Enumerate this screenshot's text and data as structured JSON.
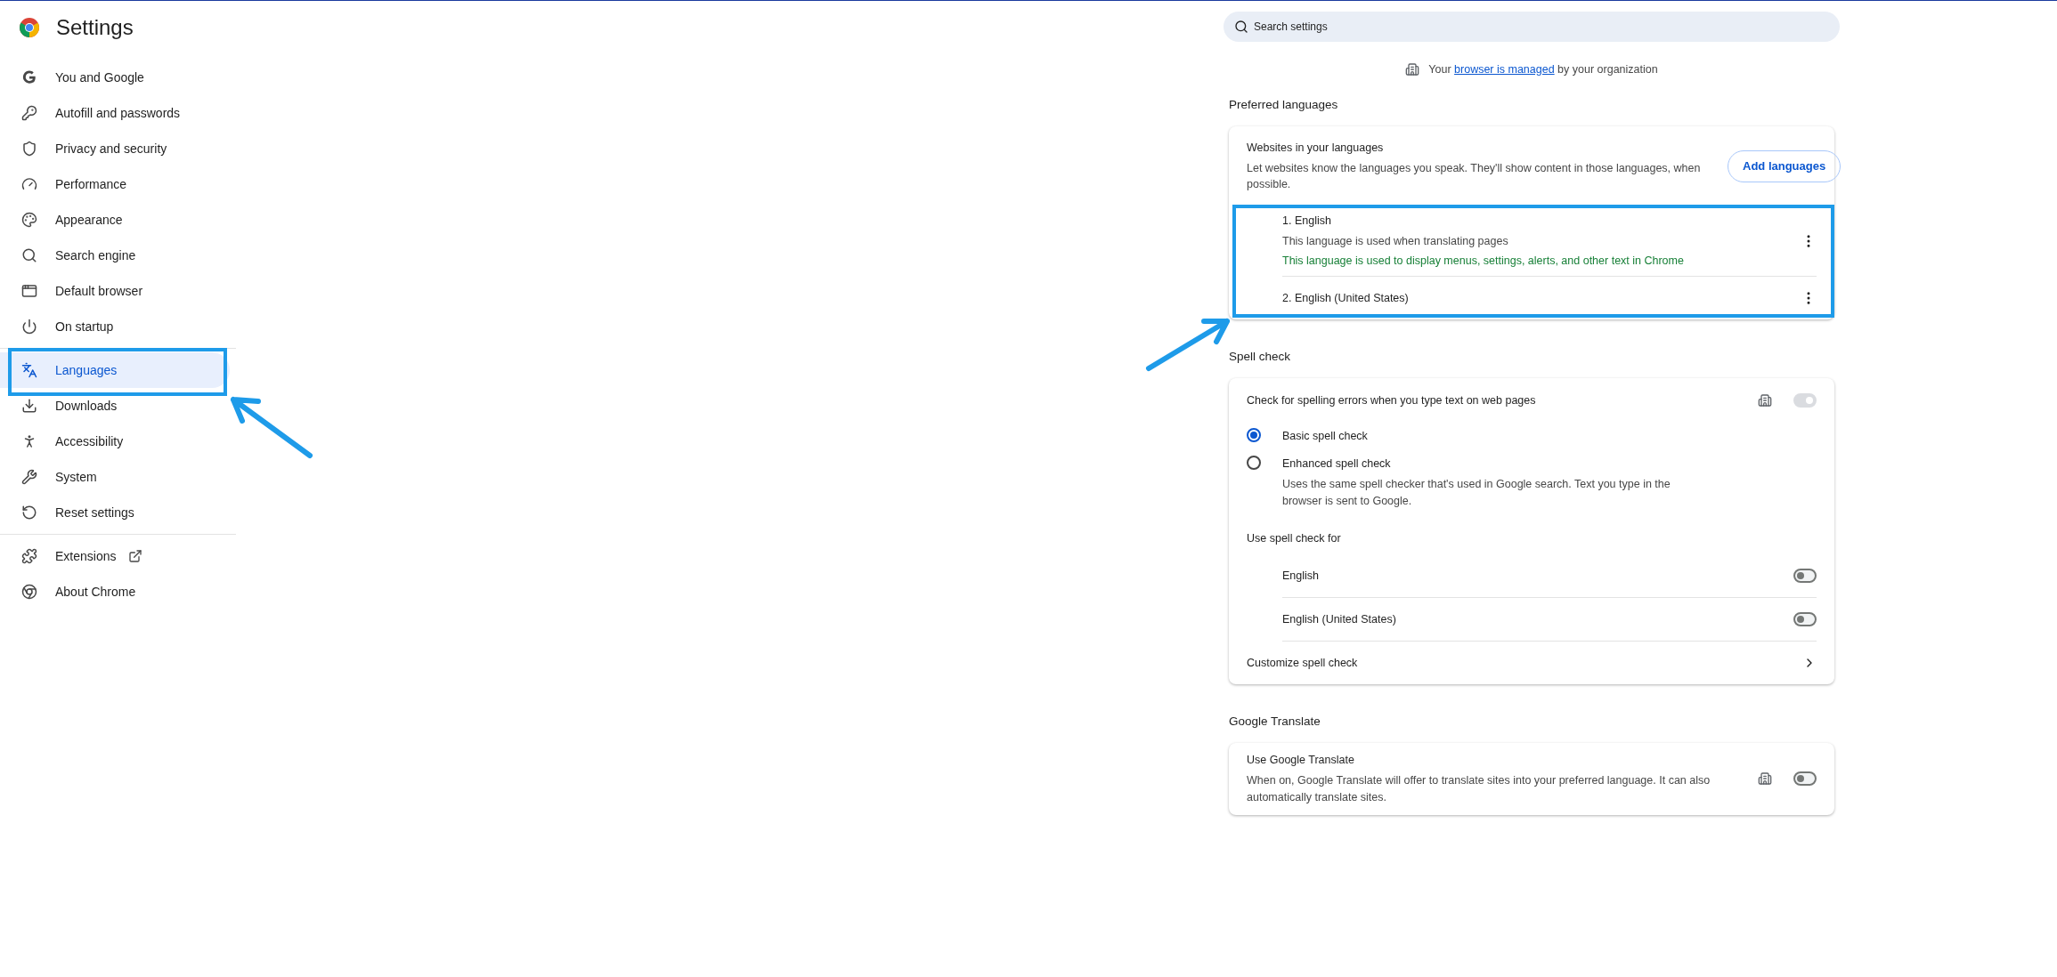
{
  "sidebar": {
    "title": "Settings",
    "sections": [
      {
        "items": [
          {
            "label": "You and Google",
            "selected": false
          },
          {
            "label": "Autofill and passwords",
            "selected": false
          },
          {
            "label": "Privacy and security",
            "selected": false
          },
          {
            "label": "Performance",
            "selected": false
          },
          {
            "label": "Appearance",
            "selected": false
          },
          {
            "label": "Search engine",
            "selected": false
          },
          {
            "label": "Default browser",
            "selected": false
          },
          {
            "label": "On startup",
            "selected": false
          }
        ]
      },
      {
        "items": [
          {
            "label": "Languages",
            "selected": true
          },
          {
            "label": "Downloads",
            "selected": false
          },
          {
            "label": "Accessibility",
            "selected": false
          },
          {
            "label": "System",
            "selected": false
          },
          {
            "label": "Reset settings",
            "selected": false
          }
        ]
      },
      {
        "items": [
          {
            "label": "Extensions",
            "selected": false
          },
          {
            "label": "About Chrome",
            "selected": false
          }
        ]
      }
    ]
  },
  "search": {
    "placeholder": "Search settings"
  },
  "managed_notice": {
    "before": "Your",
    "link": "browser is managed",
    "after": "by your organization"
  },
  "preferred_languages": {
    "heading": "Preferred languages",
    "title": "Websites in your languages",
    "description": "Let websites know the languages you speak. They'll show content in those languages, when possible.",
    "button": "Add languages",
    "languages": [
      {
        "name": "1. English",
        "notes": [
          {
            "kind": "plain",
            "text": "This language is used when translating pages"
          },
          {
            "kind": "ui",
            "text": "This language is used to display menus, settings, alerts, and other text in Chrome"
          }
        ]
      },
      {
        "name": "2. English (United States)"
      }
    ]
  },
  "spell_check": {
    "heading": "Spell check",
    "toggle": {
      "label": "Check for spelling errors when you type text on web pages",
      "managed": true,
      "on": true,
      "disabled": true
    },
    "modes": [
      {
        "label": "Basic spell check",
        "selected": true
      },
      {
        "label": "Enhanced spell check",
        "description": "Uses the same spell checker that's used in Google search. Text you type in the browser is sent to Google.",
        "selected": false
      }
    ],
    "languages_heading": "Use spell check for",
    "languages": [
      {
        "name": "English",
        "on": false
      },
      {
        "name": "English (United States)",
        "on": false
      }
    ],
    "customize": "Customize spell check"
  },
  "translate": {
    "heading": "Google Translate",
    "title": "Use Google Translate",
    "description": "When on, Google Translate will offer to translate sites into your preferred language. It can also automatically translate sites.",
    "managed": true,
    "on": false,
    "disabled": false
  }
}
